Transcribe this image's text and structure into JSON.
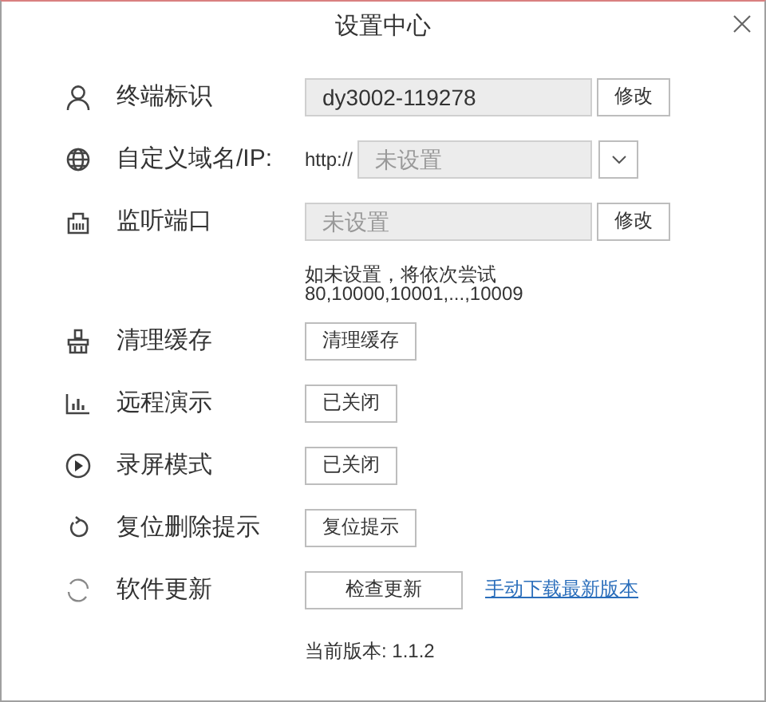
{
  "window": {
    "title": "设置中心"
  },
  "rows": [
    {
      "kind": "field",
      "label": "终端标识",
      "value": "dy3002-119278",
      "button": "修改"
    },
    {
      "kind": "domain",
      "label": "自定义域名/IP:",
      "prefix": "http://",
      "placeholder": "未设置"
    },
    {
      "kind": "field",
      "label": "监听端口",
      "placeholder": "未设置",
      "button": "修改",
      "note": [
        "如未设置，将依次尝试",
        "80,10000,10001,...,10009"
      ]
    },
    {
      "kind": "button",
      "label": "清理缓存",
      "button": "清理缓存"
    },
    {
      "kind": "button",
      "label": "远程演示",
      "button": "已关闭"
    },
    {
      "kind": "button",
      "label": "录屏模式",
      "button": "已关闭"
    },
    {
      "kind": "button",
      "label": "复位删除提示",
      "button": "复位提示"
    },
    {
      "kind": "update",
      "label": "软件更新",
      "button": "检查更新",
      "link": "手动下载最新版本",
      "version": "当前版本: 1.1.2"
    }
  ]
}
